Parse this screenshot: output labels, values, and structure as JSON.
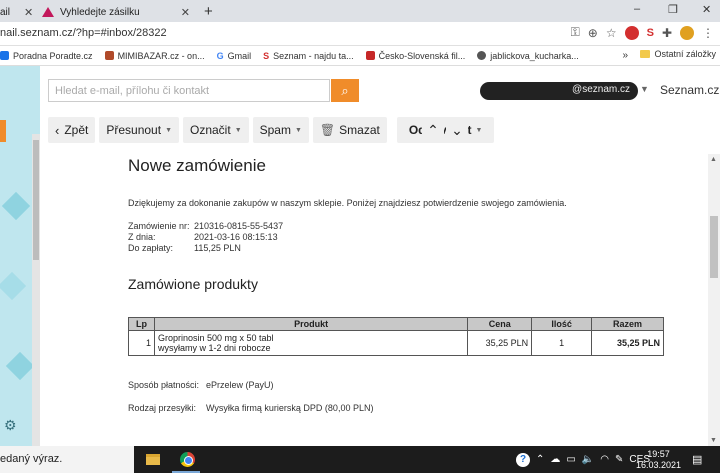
{
  "browser": {
    "tabs": [
      {
        "label": "ail",
        "active": true
      },
      {
        "label": "Vyhledejte zásilku",
        "active": false
      }
    ],
    "new_tab": "+",
    "url": "nail.seznam.cz/?hp=#inbox/28322",
    "window_controls": [
      "–",
      "❐",
      "✕"
    ],
    "bookmarks": [
      {
        "label": "Poradna Poradte.cz",
        "color": "#1a73e8"
      },
      {
        "label": "MIMIBAZAR.cz - on...",
        "color": "#b04a2a"
      },
      {
        "label": "Gmail",
        "color": "#4285f4",
        "glyph": "G"
      },
      {
        "label": "Seznam - najdu ta...",
        "color": "#d32f2f",
        "glyph": "S"
      },
      {
        "label": "Česko-Slovenská fil...",
        "color": "#c62828"
      },
      {
        "label": "jablickova_kucharka...",
        "color": "#555555"
      }
    ],
    "bookmarks_more": "»",
    "bookmarks_other": "Ostatní záložky"
  },
  "seznam": {
    "search_placeholder": "Hledat e-mail, přílohu či kontakt",
    "account": "@seznam.cz",
    "brand": "Seznam.cz"
  },
  "toolbar": {
    "back": "Zpět",
    "move": "Přesunout",
    "mark": "Označit",
    "spam": "Spam",
    "delete": "Smazat",
    "reply": "Odpovědět"
  },
  "email": {
    "title": "Nowe zamówienie",
    "thanks": "Dziękujemy za dokonanie zakupów w naszym sklepie. Poniżej znajdziesz potwierdzenie swojego zamówienia.",
    "order_info": [
      {
        "label": "Zamówienie nr:",
        "value": "210316-0815-55-5437"
      },
      {
        "label": "Z dnia:",
        "value": "2021-03-16 08:15:13"
      },
      {
        "label": "Do zapłaty:",
        "value": "115,25 PLN"
      }
    ],
    "products_title": "Zamówione produkty",
    "table": {
      "headers": [
        "Lp",
        "Produkt",
        "Cena",
        "Ilość",
        "Razem"
      ],
      "rows": [
        {
          "lp": "1",
          "product": "Groprinosin 500 mg x 50 tabl",
          "product_note": "wysyłamy w 1-2 dni robocze",
          "price": "35,25 PLN",
          "qty": "1",
          "total": "35,25 PLN"
        }
      ]
    },
    "payment": {
      "label": "Sposób płatności:",
      "value": "ePrzelew (PayU)"
    },
    "shipping": {
      "label": "Rodzaj przesyłki:",
      "value": "Wysyłka firmą kurierską DPD (80,00 PLN)"
    }
  },
  "taskbar": {
    "search_text": "edaný výraz.",
    "language": "CES",
    "time": "19:57",
    "date": "16.03.2021"
  }
}
